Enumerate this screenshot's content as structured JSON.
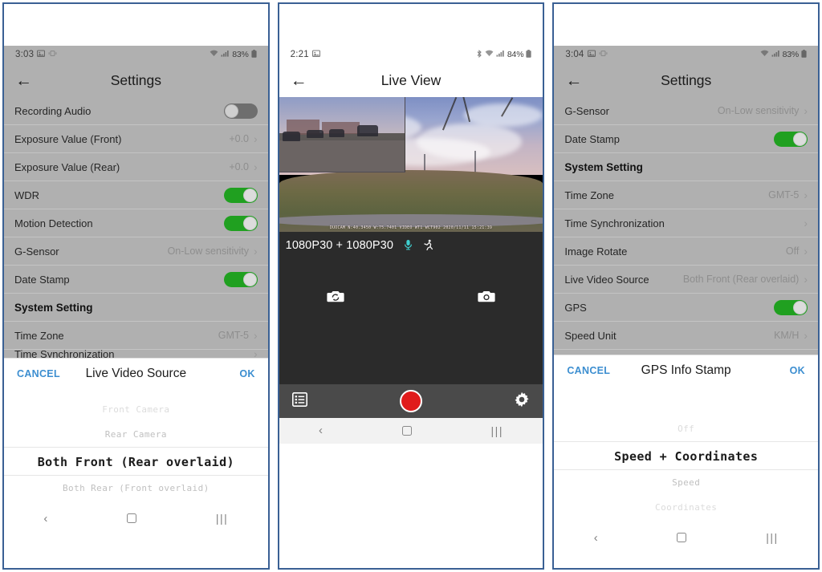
{
  "panels": [
    {
      "id": "settings-live-video-source",
      "status_bar": {
        "clock": "3:03",
        "battery": "83%",
        "icons": [
          "image-icon",
          "vibrate-icon",
          "wifi-icon",
          "signal-icon",
          "battery-icon"
        ]
      },
      "appbar": {
        "back": "←",
        "title": "Settings"
      },
      "rows": [
        {
          "label": "Recording Audio",
          "type": "toggle",
          "state": "off"
        },
        {
          "label": "Exposure Value (Front)",
          "type": "value",
          "value": "+0.0",
          "chevron": "›"
        },
        {
          "label": "Exposure Value (Rear)",
          "type": "value",
          "value": "+0.0",
          "chevron": "›"
        },
        {
          "label": "WDR",
          "type": "toggle",
          "state": "on"
        },
        {
          "label": "Motion Detection",
          "type": "toggle",
          "state": "on"
        },
        {
          "label": "G-Sensor",
          "type": "value",
          "value": "On-Low sensitivity",
          "chevron": "›"
        },
        {
          "label": "Date Stamp",
          "type": "toggle",
          "state": "on"
        },
        {
          "label": "System Setting",
          "type": "header"
        },
        {
          "label": "Time Zone",
          "type": "value",
          "value": "GMT-5",
          "chevron": "›"
        },
        {
          "label": "Time Synchronization",
          "type": "clipped",
          "value": "",
          "chevron": "›"
        }
      ],
      "dialog": {
        "cancel_label": "CANCEL",
        "title": "Live Video Source",
        "ok_label": "OK",
        "options": [
          {
            "label": "Front Camera",
            "selected": false
          },
          {
            "label": "Rear Camera",
            "selected": false
          },
          {
            "label": "Both Front (Rear overlaid)",
            "selected": true
          },
          {
            "label": "Both Rear (Front overlaid)",
            "selected": false
          }
        ]
      },
      "navbar": {
        "back": "‹",
        "home": "home-square",
        "recents": "|||"
      }
    },
    {
      "id": "live-view",
      "status_bar": {
        "clock": "2:21",
        "battery": "84%",
        "icons": [
          "image-icon",
          "bluetooth-icon",
          "wifi-icon",
          "signal-icon",
          "battery-icon"
        ]
      },
      "appbar": {
        "back": "←",
        "title": "Live View"
      },
      "video": {
        "overlay_stamp": "DUOCAM  N:40.3450  W:75.7401  VIDEO WT1 WCT902 2020/11/11 15:21:39",
        "resolution": "1080P30 + 1080P30",
        "mic_icon": "microphone-icon",
        "motion_icon": "motion-icon",
        "switch_camera_icon": "switch-camera-icon",
        "snapshot_icon": "camera-icon"
      },
      "controls": {
        "gallery_icon": "list-icon",
        "record_label": "record-button",
        "settings_icon": "gear-icon"
      },
      "navbar": {
        "back": "‹",
        "home": "home-square",
        "recents": "|||"
      }
    },
    {
      "id": "settings-gps-info-stamp",
      "status_bar": {
        "clock": "3:04",
        "battery": "83%",
        "icons": [
          "image-icon",
          "vibrate-icon",
          "wifi-icon",
          "signal-icon",
          "battery-icon"
        ]
      },
      "appbar": {
        "back": "←",
        "title": "Settings"
      },
      "rows": [
        {
          "label": "G-Sensor",
          "type": "value",
          "value": "On-Low sensitivity",
          "chevron": "›"
        },
        {
          "label": "Date Stamp",
          "type": "toggle",
          "state": "on"
        },
        {
          "label": "System Setting",
          "type": "header"
        },
        {
          "label": "Time Zone",
          "type": "value",
          "value": "GMT-5",
          "chevron": "›"
        },
        {
          "label": "Time Synchronization",
          "type": "value",
          "value": "",
          "chevron": "›"
        },
        {
          "label": "Image Rotate",
          "type": "value",
          "value": "Off",
          "chevron": "›"
        },
        {
          "label": "Live Video Source",
          "type": "value",
          "value": "Both Front (Rear overlaid)",
          "chevron": "›"
        },
        {
          "label": "GPS",
          "type": "toggle",
          "state": "on"
        },
        {
          "label": "Speed Unit",
          "type": "value",
          "value": "KM/H",
          "chevron": "›"
        }
      ],
      "dialog": {
        "cancel_label": "CANCEL",
        "title": "GPS Info Stamp",
        "ok_label": "OK",
        "options": [
          {
            "label": "Off",
            "selected": false
          },
          {
            "label": "Speed + Coordinates",
            "selected": true
          },
          {
            "label": "Speed",
            "selected": false
          },
          {
            "label": "Coordinates",
            "selected": false
          }
        ]
      },
      "navbar": {
        "back": "‹",
        "home": "home-square",
        "recents": "|||"
      }
    }
  ],
  "colors": {
    "frame_border": "#3a6094",
    "toggle_on": "#20a020",
    "toggle_off": "#6e6e6e",
    "accent_link": "#3c8ed0",
    "record_red": "#e01b1b",
    "settings_bg": "#b0b0b0"
  }
}
